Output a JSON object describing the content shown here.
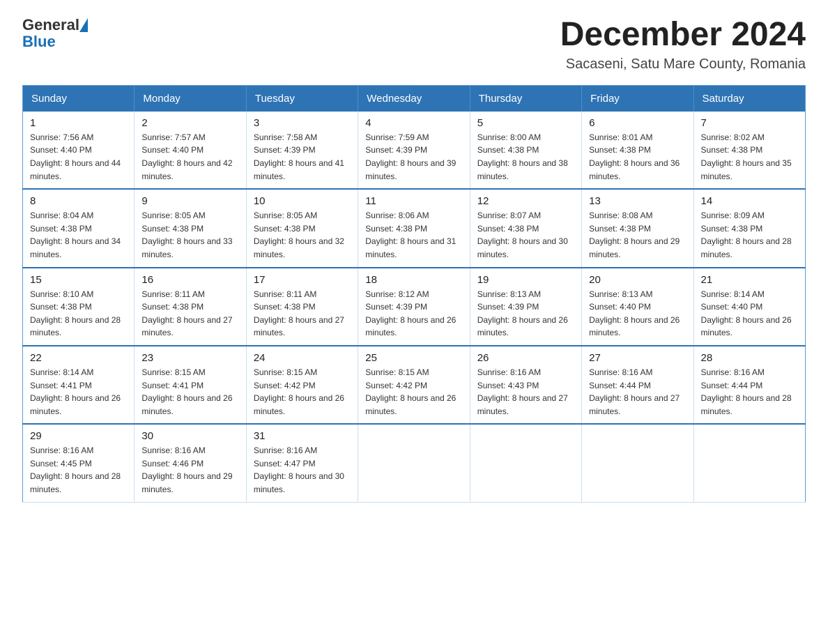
{
  "header": {
    "logo_general": "General",
    "logo_blue": "Blue",
    "title": "December 2024",
    "subtitle": "Sacaseni, Satu Mare County, Romania"
  },
  "weekdays": [
    "Sunday",
    "Monday",
    "Tuesday",
    "Wednesday",
    "Thursday",
    "Friday",
    "Saturday"
  ],
  "weeks": [
    [
      {
        "day": "1",
        "sunrise": "7:56 AM",
        "sunset": "4:40 PM",
        "daylight": "8 hours and 44 minutes."
      },
      {
        "day": "2",
        "sunrise": "7:57 AM",
        "sunset": "4:40 PM",
        "daylight": "8 hours and 42 minutes."
      },
      {
        "day": "3",
        "sunrise": "7:58 AM",
        "sunset": "4:39 PM",
        "daylight": "8 hours and 41 minutes."
      },
      {
        "day": "4",
        "sunrise": "7:59 AM",
        "sunset": "4:39 PM",
        "daylight": "8 hours and 39 minutes."
      },
      {
        "day": "5",
        "sunrise": "8:00 AM",
        "sunset": "4:38 PM",
        "daylight": "8 hours and 38 minutes."
      },
      {
        "day": "6",
        "sunrise": "8:01 AM",
        "sunset": "4:38 PM",
        "daylight": "8 hours and 36 minutes."
      },
      {
        "day": "7",
        "sunrise": "8:02 AM",
        "sunset": "4:38 PM",
        "daylight": "8 hours and 35 minutes."
      }
    ],
    [
      {
        "day": "8",
        "sunrise": "8:04 AM",
        "sunset": "4:38 PM",
        "daylight": "8 hours and 34 minutes."
      },
      {
        "day": "9",
        "sunrise": "8:05 AM",
        "sunset": "4:38 PM",
        "daylight": "8 hours and 33 minutes."
      },
      {
        "day": "10",
        "sunrise": "8:05 AM",
        "sunset": "4:38 PM",
        "daylight": "8 hours and 32 minutes."
      },
      {
        "day": "11",
        "sunrise": "8:06 AM",
        "sunset": "4:38 PM",
        "daylight": "8 hours and 31 minutes."
      },
      {
        "day": "12",
        "sunrise": "8:07 AM",
        "sunset": "4:38 PM",
        "daylight": "8 hours and 30 minutes."
      },
      {
        "day": "13",
        "sunrise": "8:08 AM",
        "sunset": "4:38 PM",
        "daylight": "8 hours and 29 minutes."
      },
      {
        "day": "14",
        "sunrise": "8:09 AM",
        "sunset": "4:38 PM",
        "daylight": "8 hours and 28 minutes."
      }
    ],
    [
      {
        "day": "15",
        "sunrise": "8:10 AM",
        "sunset": "4:38 PM",
        "daylight": "8 hours and 28 minutes."
      },
      {
        "day": "16",
        "sunrise": "8:11 AM",
        "sunset": "4:38 PM",
        "daylight": "8 hours and 27 minutes."
      },
      {
        "day": "17",
        "sunrise": "8:11 AM",
        "sunset": "4:38 PM",
        "daylight": "8 hours and 27 minutes."
      },
      {
        "day": "18",
        "sunrise": "8:12 AM",
        "sunset": "4:39 PM",
        "daylight": "8 hours and 26 minutes."
      },
      {
        "day": "19",
        "sunrise": "8:13 AM",
        "sunset": "4:39 PM",
        "daylight": "8 hours and 26 minutes."
      },
      {
        "day": "20",
        "sunrise": "8:13 AM",
        "sunset": "4:40 PM",
        "daylight": "8 hours and 26 minutes."
      },
      {
        "day": "21",
        "sunrise": "8:14 AM",
        "sunset": "4:40 PM",
        "daylight": "8 hours and 26 minutes."
      }
    ],
    [
      {
        "day": "22",
        "sunrise": "8:14 AM",
        "sunset": "4:41 PM",
        "daylight": "8 hours and 26 minutes."
      },
      {
        "day": "23",
        "sunrise": "8:15 AM",
        "sunset": "4:41 PM",
        "daylight": "8 hours and 26 minutes."
      },
      {
        "day": "24",
        "sunrise": "8:15 AM",
        "sunset": "4:42 PM",
        "daylight": "8 hours and 26 minutes."
      },
      {
        "day": "25",
        "sunrise": "8:15 AM",
        "sunset": "4:42 PM",
        "daylight": "8 hours and 26 minutes."
      },
      {
        "day": "26",
        "sunrise": "8:16 AM",
        "sunset": "4:43 PM",
        "daylight": "8 hours and 27 minutes."
      },
      {
        "day": "27",
        "sunrise": "8:16 AM",
        "sunset": "4:44 PM",
        "daylight": "8 hours and 27 minutes."
      },
      {
        "day": "28",
        "sunrise": "8:16 AM",
        "sunset": "4:44 PM",
        "daylight": "8 hours and 28 minutes."
      }
    ],
    [
      {
        "day": "29",
        "sunrise": "8:16 AM",
        "sunset": "4:45 PM",
        "daylight": "8 hours and 28 minutes."
      },
      {
        "day": "30",
        "sunrise": "8:16 AM",
        "sunset": "4:46 PM",
        "daylight": "8 hours and 29 minutes."
      },
      {
        "day": "31",
        "sunrise": "8:16 AM",
        "sunset": "4:47 PM",
        "daylight": "8 hours and 30 minutes."
      },
      null,
      null,
      null,
      null
    ]
  ]
}
